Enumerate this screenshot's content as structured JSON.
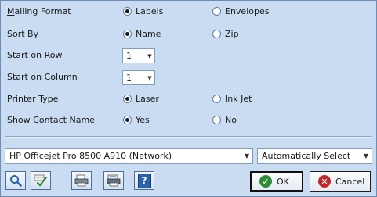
{
  "mailing_format": {
    "label": "Mailing Format",
    "options": [
      "Labels",
      "Envelopes"
    ],
    "selected": "Labels"
  },
  "sort_by": {
    "label": "Sort By",
    "options": [
      "Name",
      "Zip"
    ],
    "selected": "Name"
  },
  "start_row": {
    "label": "Start on Row",
    "value": "1"
  },
  "start_column": {
    "label": "Start on Column",
    "value": "1"
  },
  "printer_type": {
    "label": "Printer Type",
    "options": [
      "Laser",
      "Ink Jet"
    ],
    "selected": "Laser"
  },
  "show_contact_name": {
    "label": "Show Contact Name",
    "options": [
      "Yes",
      "No"
    ],
    "selected": "Yes"
  },
  "printer_select": {
    "value": "HP Officejet Pro 8500 A910 (Network)"
  },
  "tray_select": {
    "value": "Automatically Select"
  },
  "toolbar": {
    "icons": [
      "zoom-icon",
      "spell-check-icon",
      "print-preview-icon",
      "printer-setup-icon",
      "help-icon"
    ],
    "help_glyph": "?"
  },
  "buttons": {
    "ok_label": "OK",
    "cancel_label": "Cancel"
  },
  "colors": {
    "background": "#c9dcf2",
    "ok_accent": "#2f8a3a",
    "cancel_accent": "#c4242b"
  }
}
